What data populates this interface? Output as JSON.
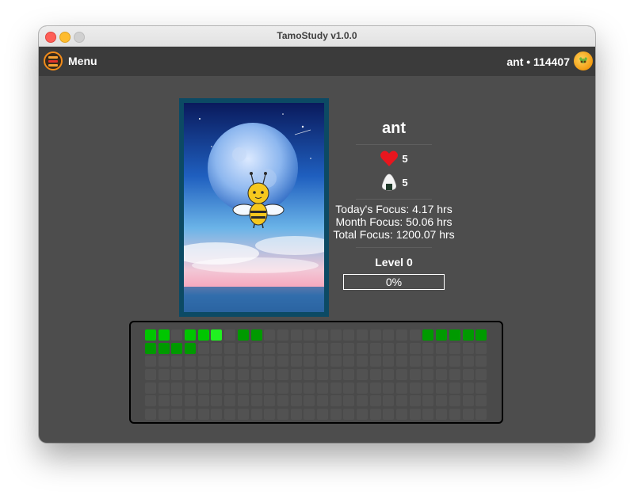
{
  "window": {
    "title": "TamoStudy v1.0.0"
  },
  "toolbar": {
    "menu_label": "Menu",
    "user_text": "ant • 114407"
  },
  "pet": {
    "name": "ant",
    "hearts": "5",
    "food": "5",
    "today_focus": "Today's Focus: 4.17 hrs",
    "month_focus": "Month Focus: 50.06 hrs",
    "total_focus": "Total Focus: 1200.07 hrs",
    "level": "Level 0",
    "progress_text": "0%",
    "progress_value": 0
  },
  "calendar": {
    "columns": 26,
    "rows": 7,
    "cells": [
      [
        3,
        3,
        0,
        3,
        3,
        4,
        0,
        2,
        2,
        0,
        0,
        0,
        0,
        0,
        0,
        0,
        0,
        0,
        0,
        0,
        0,
        2,
        2,
        2,
        2,
        2
      ],
      [
        2,
        2,
        2,
        2,
        0,
        0,
        0,
        0,
        0,
        0,
        0,
        0,
        0,
        0,
        0,
        0,
        0,
        0,
        0,
        0,
        0,
        0,
        0,
        0,
        0,
        0
      ],
      [
        0,
        0,
        0,
        0,
        0,
        0,
        0,
        0,
        0,
        0,
        0,
        0,
        0,
        0,
        0,
        0,
        0,
        0,
        0,
        0,
        0,
        0,
        0,
        0,
        0,
        0
      ],
      [
        0,
        0,
        0,
        0,
        0,
        0,
        0,
        0,
        0,
        0,
        0,
        0,
        0,
        0,
        0,
        0,
        0,
        0,
        0,
        0,
        0,
        0,
        0,
        0,
        0,
        0
      ],
      [
        0,
        0,
        0,
        0,
        0,
        0,
        0,
        0,
        0,
        0,
        0,
        0,
        0,
        0,
        0,
        0,
        0,
        0,
        0,
        0,
        0,
        0,
        0,
        0,
        0,
        0
      ],
      [
        0,
        0,
        0,
        0,
        0,
        0,
        0,
        0,
        0,
        0,
        0,
        0,
        0,
        0,
        0,
        0,
        0,
        0,
        0,
        0,
        0,
        0,
        0,
        0,
        0,
        0
      ],
      [
        0,
        0,
        0,
        0,
        0,
        0,
        0,
        0,
        0,
        0,
        0,
        0,
        0,
        0,
        0,
        0,
        0,
        0,
        0,
        0,
        0,
        0,
        0,
        0,
        0,
        0
      ]
    ]
  },
  "colors": {
    "accent_orange": "#f28c1a",
    "heart_red": "#e8161e",
    "activity_green": "#20f020"
  },
  "icons": {
    "menu": "hamburger-icon",
    "avatar": "coin-avatar-icon",
    "heart": "heart-icon",
    "food": "rice-ball-icon",
    "pet": "bee-icon"
  }
}
